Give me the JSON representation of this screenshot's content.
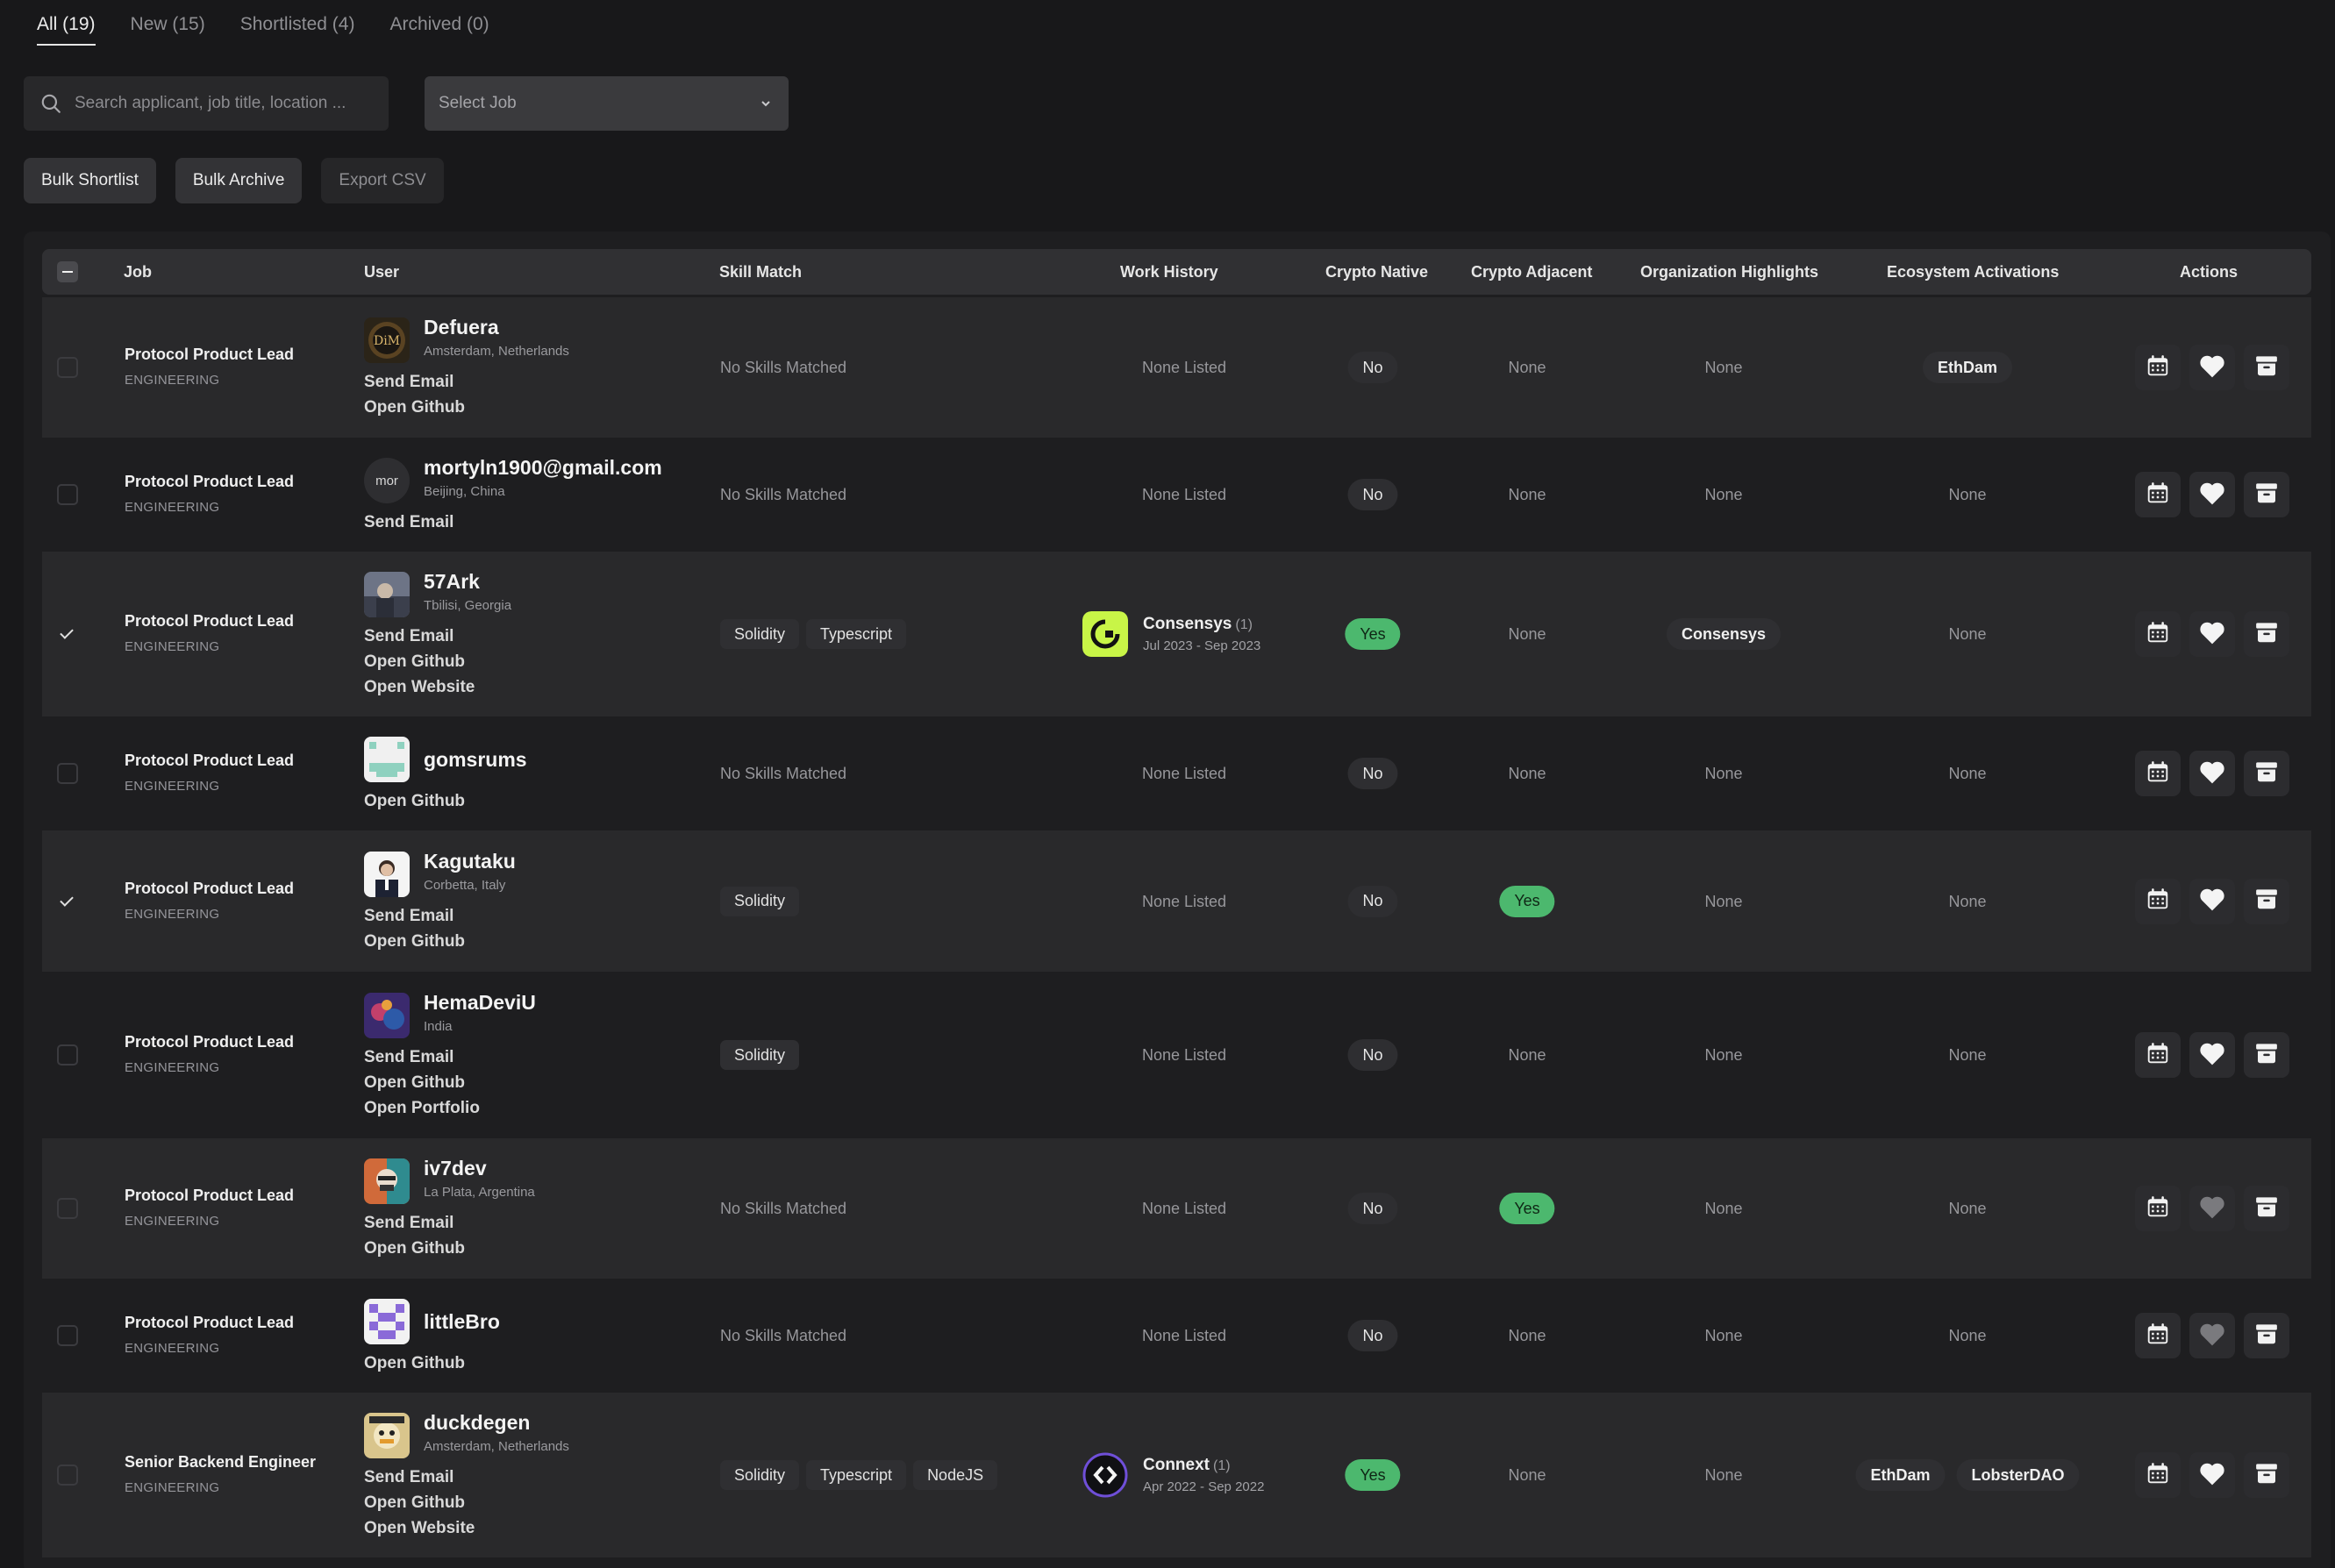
{
  "tabs": [
    {
      "label": "All (19)",
      "active": true
    },
    {
      "label": "New (15)"
    },
    {
      "label": "Shortlisted (4)"
    },
    {
      "label": "Archived (0)"
    }
  ],
  "search": {
    "placeholder": "Search applicant, job title, location ..."
  },
  "job_select": {
    "value": "Select Job"
  },
  "bulk_actions": {
    "shortlist": "Bulk Shortlist",
    "archive": "Bulk Archive",
    "export": "Export CSV"
  },
  "table": {
    "headers": {
      "job": "Job",
      "user": "User",
      "skill_match": "Skill Match",
      "work_history": "Work History",
      "crypto_native": "Crypto Native",
      "crypto_adjacent": "Crypto Adjacent",
      "org_highlights": "Organization Highlights",
      "ecosystem_activations": "Ecosystem Activations",
      "actions": "Actions"
    },
    "rows": [
      {
        "checked": false,
        "job_title": "Protocol Product Lead",
        "job_dept": "ENGINEERING",
        "avatar": "defuera-avatar",
        "name": "Defuera",
        "location": "Amsterdam, Netherlands",
        "links": [
          "Send Email",
          "Open Github"
        ],
        "skills": [],
        "no_skills": "No Skills Matched",
        "work_history": null,
        "work_none": "None Listed",
        "crypto_native": "No",
        "crypto_adjacent": "None",
        "org_highlights": "None",
        "org_highlight_tags": [],
        "ecosystem": [
          "EthDam"
        ],
        "ecosystem_none": "",
        "heart_active": true
      },
      {
        "checked": false,
        "job_title": "Protocol Product Lead",
        "job_dept": "ENGINEERING",
        "avatar": "initials-avatar",
        "initials": "mor",
        "name": "mortyln1900@gmail.com",
        "location": "Beijing, China",
        "links": [
          "Send Email"
        ],
        "skills": [],
        "no_skills": "No Skills Matched",
        "work_history": null,
        "work_none": "None Listed",
        "crypto_native": "No",
        "crypto_adjacent": "None",
        "org_highlights": "None",
        "org_highlight_tags": [],
        "ecosystem": [],
        "ecosystem_none": "None",
        "heart_active": true
      },
      {
        "checked": true,
        "job_title": "Protocol Product Lead",
        "job_dept": "ENGINEERING",
        "avatar": "57ark-avatar",
        "name": "57Ark",
        "location": "Tbilisi, Georgia",
        "links": [
          "Send Email",
          "Open Github",
          "Open Website"
        ],
        "skills": [
          "Solidity",
          "Typescript"
        ],
        "no_skills": "",
        "work_history": {
          "org": "Consensys",
          "count": "(1)",
          "dates": "Jul 2023 - Sep 2023",
          "logo": "consensys-logo"
        },
        "work_none": "",
        "crypto_native": "Yes",
        "crypto_adjacent": "None",
        "org_highlights": "",
        "org_highlight_tags": [
          "Consensys"
        ],
        "ecosystem": [],
        "ecosystem_none": "None",
        "heart_active": true
      },
      {
        "checked": false,
        "job_title": "Protocol Product Lead",
        "job_dept": "ENGINEERING",
        "avatar": "gomsrums-avatar",
        "name": "gomsrums",
        "location": "",
        "links": [
          "Open Github"
        ],
        "skills": [],
        "no_skills": "No Skills Matched",
        "work_history": null,
        "work_none": "None Listed",
        "crypto_native": "No",
        "crypto_adjacent": "None",
        "org_highlights": "None",
        "org_highlight_tags": [],
        "ecosystem": [],
        "ecosystem_none": "None",
        "heart_active": true
      },
      {
        "checked": true,
        "job_title": "Protocol Product Lead",
        "job_dept": "ENGINEERING",
        "avatar": "kagutaku-avatar",
        "name": "Kagutaku",
        "location": "Corbetta, Italy",
        "links": [
          "Send Email",
          "Open Github"
        ],
        "skills": [
          "Solidity"
        ],
        "no_skills": "",
        "work_history": null,
        "work_none": "None Listed",
        "crypto_native": "No",
        "crypto_adjacent": "Yes",
        "org_highlights": "None",
        "org_highlight_tags": [],
        "ecosystem": [],
        "ecosystem_none": "None",
        "heart_active": true
      },
      {
        "checked": false,
        "job_title": "Protocol Product Lead",
        "job_dept": "ENGINEERING",
        "avatar": "hemadeviu-avatar",
        "name": "HemaDeviU",
        "location": "India",
        "links": [
          "Send Email",
          "Open Github",
          "Open Portfolio"
        ],
        "skills": [
          "Solidity"
        ],
        "no_skills": "",
        "work_history": null,
        "work_none": "None Listed",
        "crypto_native": "No",
        "crypto_adjacent": "None",
        "org_highlights": "None",
        "org_highlight_tags": [],
        "ecosystem": [],
        "ecosystem_none": "None",
        "heart_active": true
      },
      {
        "checked": false,
        "job_title": "Protocol Product Lead",
        "job_dept": "ENGINEERING",
        "avatar": "iv7dev-avatar",
        "name": "iv7dev",
        "location": "La Plata, Argentina",
        "links": [
          "Send Email",
          "Open Github"
        ],
        "skills": [],
        "no_skills": "No Skills Matched",
        "work_history": null,
        "work_none": "None Listed",
        "crypto_native": "No",
        "crypto_adjacent": "Yes",
        "org_highlights": "None",
        "org_highlight_tags": [],
        "ecosystem": [],
        "ecosystem_none": "None",
        "heart_active": false
      },
      {
        "checked": false,
        "job_title": "Protocol Product Lead",
        "job_dept": "ENGINEERING",
        "avatar": "littlebro-avatar",
        "name": "littleBro",
        "location": "",
        "links": [
          "Open Github"
        ],
        "skills": [],
        "no_skills": "No Skills Matched",
        "work_history": null,
        "work_none": "None Listed",
        "crypto_native": "No",
        "crypto_adjacent": "None",
        "org_highlights": "None",
        "org_highlight_tags": [],
        "ecosystem": [],
        "ecosystem_none": "None",
        "heart_active": false
      },
      {
        "checked": false,
        "job_title": "Senior Backend Engineer",
        "job_dept": "ENGINEERING",
        "avatar": "duckdegen-avatar",
        "name": "duckdegen",
        "location": "Amsterdam, Netherlands",
        "links": [
          "Send Email",
          "Open Github",
          "Open Website"
        ],
        "skills": [
          "Solidity",
          "Typescript",
          "NodeJS"
        ],
        "no_skills": "",
        "work_history": {
          "org": "Connext",
          "count": "(1)",
          "dates": "Apr 2022 - Sep 2022",
          "logo": "connext-logo"
        },
        "work_none": "",
        "crypto_native": "Yes",
        "crypto_adjacent": "None",
        "org_highlights": "None",
        "org_highlight_tags": [],
        "ecosystem": [
          "EthDam",
          "LobsterDAO"
        ],
        "ecosystem_none": "",
        "heart_active": true
      }
    ]
  },
  "colors": {
    "background": "#18181a",
    "row_alt": "#29292b",
    "yes_green": "#4cb86e",
    "consensys_lime": "#c8f547"
  },
  "icons": {
    "calendar": "calendar-icon",
    "heart": "heart-icon",
    "archive": "archive-icon",
    "search": "search-icon",
    "chevron": "chevron-down-icon"
  }
}
